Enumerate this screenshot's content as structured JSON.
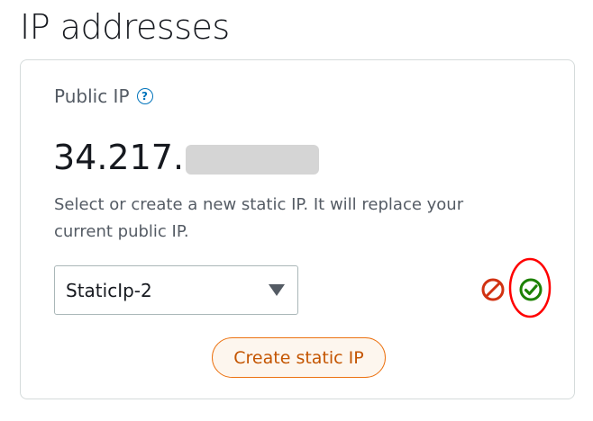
{
  "page": {
    "title": "IP addresses"
  },
  "public_ip": {
    "label": "Public IP",
    "help_glyph": "?",
    "address_visible": "34.217.",
    "address_redacted": true,
    "description": "Select or create a new static IP. It will replace your current public IP."
  },
  "static_ip_select": {
    "selected_value": "StaticIp-2"
  },
  "actions": {
    "cancel_icon": "cancel-circle-slash-icon",
    "confirm_icon": "check-circle-icon",
    "create_button_label": "Create static IP"
  },
  "colors": {
    "accent_orange": "#ec7211",
    "button_text": "#c45500",
    "cancel_red": "#d13212",
    "confirm_green": "#1d8102",
    "annotation_red": "#ff0000",
    "help_blue": "#0073bb"
  }
}
